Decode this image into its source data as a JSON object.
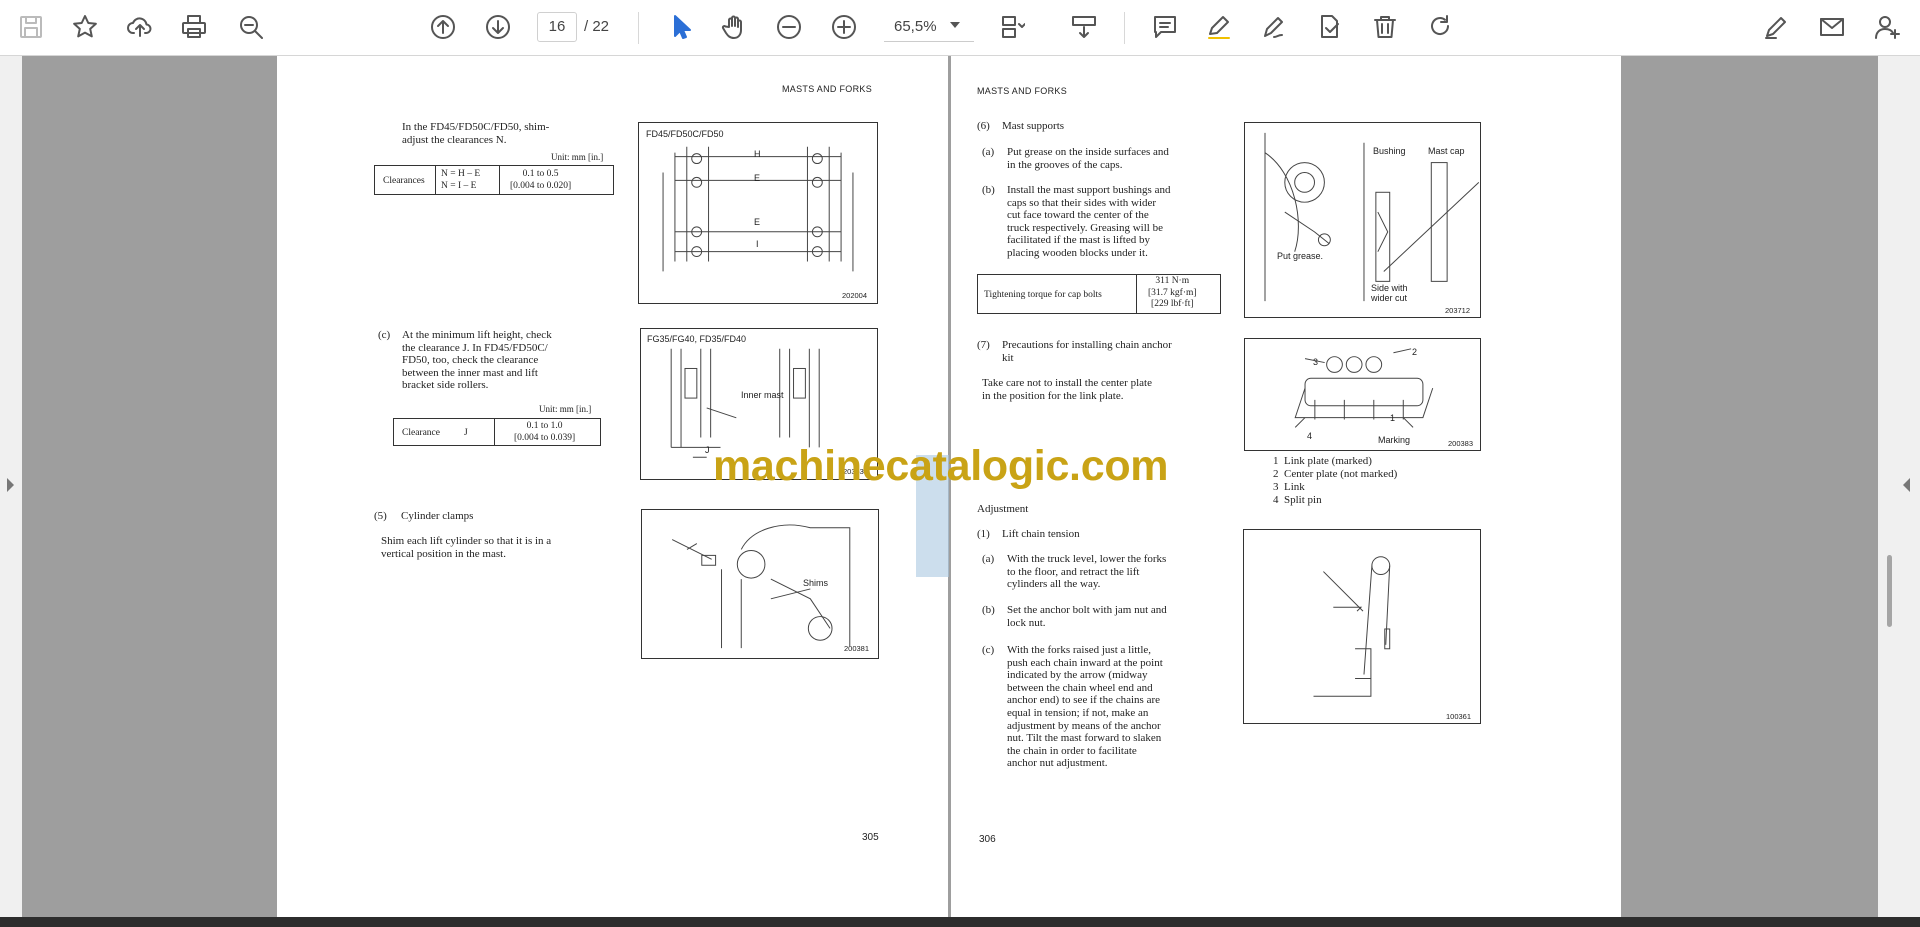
{
  "toolbar": {
    "page_current": "16",
    "page_total": "/ 22",
    "zoom": "65,5%"
  },
  "icons": {
    "save": "save-icon",
    "bookmark": "star-icon",
    "upload": "upload-icon",
    "print": "print-icon",
    "zoom_find": "zoom-search-icon",
    "prev": "arrow-up-circle-icon",
    "next": "arrow-down-circle-icon",
    "select": "cursor-icon",
    "hand": "hand-icon",
    "zoom_out": "minus-circle-icon",
    "zoom_in": "plus-circle-icon"
  },
  "watermark": "machinecatalogic.com",
  "colors": {
    "watermark": "#c9a316",
    "toolbar_bg": "#ffffff",
    "canvas": "#9e9e9e"
  },
  "left_page": {
    "header": "MASTS AND FORKS",
    "p1": "In the FD45/FD50C/FD50, shim-\nadjust the clearances N.",
    "unit1": "Unit: mm [in.]",
    "table1": {
      "label": "Clearances",
      "formula": "N = H – E\nN = I – E",
      "value": "0.1 to 0.5\n[0.004 to 0.020]"
    },
    "fig1": {
      "title": "FD45/FD50C/FD50",
      "labels": [
        "H",
        "E",
        "E",
        "I"
      ],
      "num": "202004"
    },
    "c_label": "(c)",
    "c_text": "At the minimum lift height, check\nthe clearance J. In FD45/FD50C/\nFD50, too, check the clearance\nbetween the inner mast and lift\nbracket side rollers.",
    "unit2": "Unit: mm [in.]",
    "table2": {
      "label": "Clearance",
      "sym": "J",
      "value": "0.1 to 1.0\n[0.004 to 0.039]"
    },
    "fig2": {
      "title": "FG35/FG40, FD35/FD40",
      "label": "Inner mast",
      "j": "J",
      "num": "203538"
    },
    "s5_label": "(5)",
    "s5_title": "Cylinder clamps",
    "s5_text": "Shim each lift cylinder so that it is in a\nvertical position in the mast.",
    "fig3": {
      "label": "Shims",
      "num": "200381"
    },
    "page_num": "305"
  },
  "right_page": {
    "header": "MASTS AND FORKS",
    "s6_label": "(6)",
    "s6_title": "Mast supports",
    "a_label": "(a)",
    "a_text": "Put grease on the inside surfaces and\nin the grooves of the caps.",
    "b_label": "(b)",
    "b_text": "Install the mast support bushings and\ncaps so that their sides with wider\ncut face toward the center of the\ntruck respectively. Greasing will be\nfacilitated if the mast is lifted by\nplacing wooden blocks under it.",
    "torque": {
      "label": "Tightening torque for cap bolts",
      "value": "311 N·m\n[31.7 kgf·m]\n[229 lbf·ft]"
    },
    "fig4": {
      "bushing": "Bushing",
      "mastcap": "Mast cap",
      "grease": "Put grease.",
      "side": "Side with\nwider cut",
      "num": "203712"
    },
    "s7_label": "(7)",
    "s7_title": "Precautions for installing chain anchor\nkit",
    "s7_text": "Take care not to install the center plate\nin the position for the link plate.",
    "fig5": {
      "marking": "Marking",
      "n1": "1",
      "n2": "2",
      "n3": "3",
      "n4": "4",
      "num": "200383"
    },
    "legend": [
      "1  Link plate (marked)",
      "2  Center plate (not marked)",
      "3  Link",
      "4  Split pin"
    ],
    "adj_title": "Adjustment",
    "s1_label": "(1)",
    "s1_title": "Lift chain tension",
    "ra_label": "(a)",
    "ra_text": "With the truck level, lower the forks\nto the floor, and retract the lift\ncylinders all the way.",
    "rb_label": "(b)",
    "rb_text": "Set the anchor bolt with jam nut and\nlock nut.",
    "rc_label": "(c)",
    "rc_text": "With the forks raised just a little,\npush each chain inward at the point\nindicated by the arrow (midway\nbetween the chain wheel end and\nanchor end) to see if the chains are\nequal in tension; if not, make an\nadjustment by means of the anchor\nnut. Tilt the mast forward to slaken\nthe chain in order to facilitate\nanchor nut adjustment.",
    "fig6": {
      "num": "100361"
    },
    "page_num": "306"
  }
}
